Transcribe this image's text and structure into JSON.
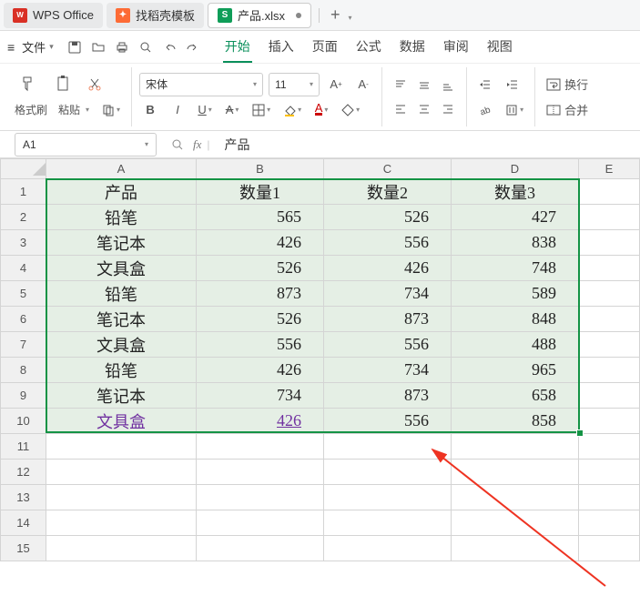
{
  "tabs": {
    "t0": {
      "label": "WPS Office"
    },
    "t1": {
      "label": "找稻壳模板"
    },
    "t2": {
      "label": "产品.xlsx"
    },
    "plus": "+"
  },
  "menu": {
    "file": "文件",
    "ribbon": {
      "start": "开始",
      "insert": "插入",
      "page": "页面",
      "formula": "公式",
      "data": "数据",
      "review": "审阅",
      "view": "视图"
    }
  },
  "toolbar": {
    "format_painter": "格式刷",
    "paste": "粘贴",
    "font_name": "宋体",
    "font_size": "11",
    "wrap": "换行",
    "merge": "合并"
  },
  "formula_bar": {
    "name": "A1",
    "fx": "fx",
    "value": "产品"
  },
  "sheet": {
    "cols": [
      "A",
      "B",
      "C",
      "D",
      "E"
    ],
    "rowcount": 15,
    "data": [
      [
        "产品",
        "数量1",
        "数量2",
        "数量3"
      ],
      [
        "铅笔",
        "565",
        "526",
        "427"
      ],
      [
        "笔记本",
        "426",
        "556",
        "838"
      ],
      [
        "文具盒",
        "526",
        "426",
        "748"
      ],
      [
        "铅笔",
        "873",
        "734",
        "589"
      ],
      [
        "笔记本",
        "526",
        "873",
        "848"
      ],
      [
        "文具盒",
        "556",
        "556",
        "488"
      ],
      [
        "铅笔",
        "426",
        "734",
        "965"
      ],
      [
        "笔记本",
        "734",
        "873",
        "658"
      ],
      [
        "文具盒",
        "426",
        "556",
        "858"
      ]
    ]
  },
  "chart_data": {
    "type": "table",
    "title": "产品",
    "columns": [
      "产品",
      "数量1",
      "数量2",
      "数量3"
    ],
    "rows": [
      {
        "产品": "铅笔",
        "数量1": 565,
        "数量2": 526,
        "数量3": 427
      },
      {
        "产品": "笔记本",
        "数量1": 426,
        "数量2": 556,
        "数量3": 838
      },
      {
        "产品": "文具盒",
        "数量1": 526,
        "数量2": 426,
        "数量3": 748
      },
      {
        "产品": "铅笔",
        "数量1": 873,
        "数量2": 734,
        "数量3": 589
      },
      {
        "产品": "笔记本",
        "数量1": 526,
        "数量2": 873,
        "数量3": 848
      },
      {
        "产品": "文具盒",
        "数量1": 556,
        "数量2": 556,
        "数量3": 488
      },
      {
        "产品": "铅笔",
        "数量1": 426,
        "数量2": 734,
        "数量3": 965
      },
      {
        "产品": "笔记本",
        "数量1": 734,
        "数量2": 873,
        "数量3": 658
      },
      {
        "产品": "文具盒",
        "数量1": 426,
        "数量2": 556,
        "数量3": 858
      }
    ]
  }
}
